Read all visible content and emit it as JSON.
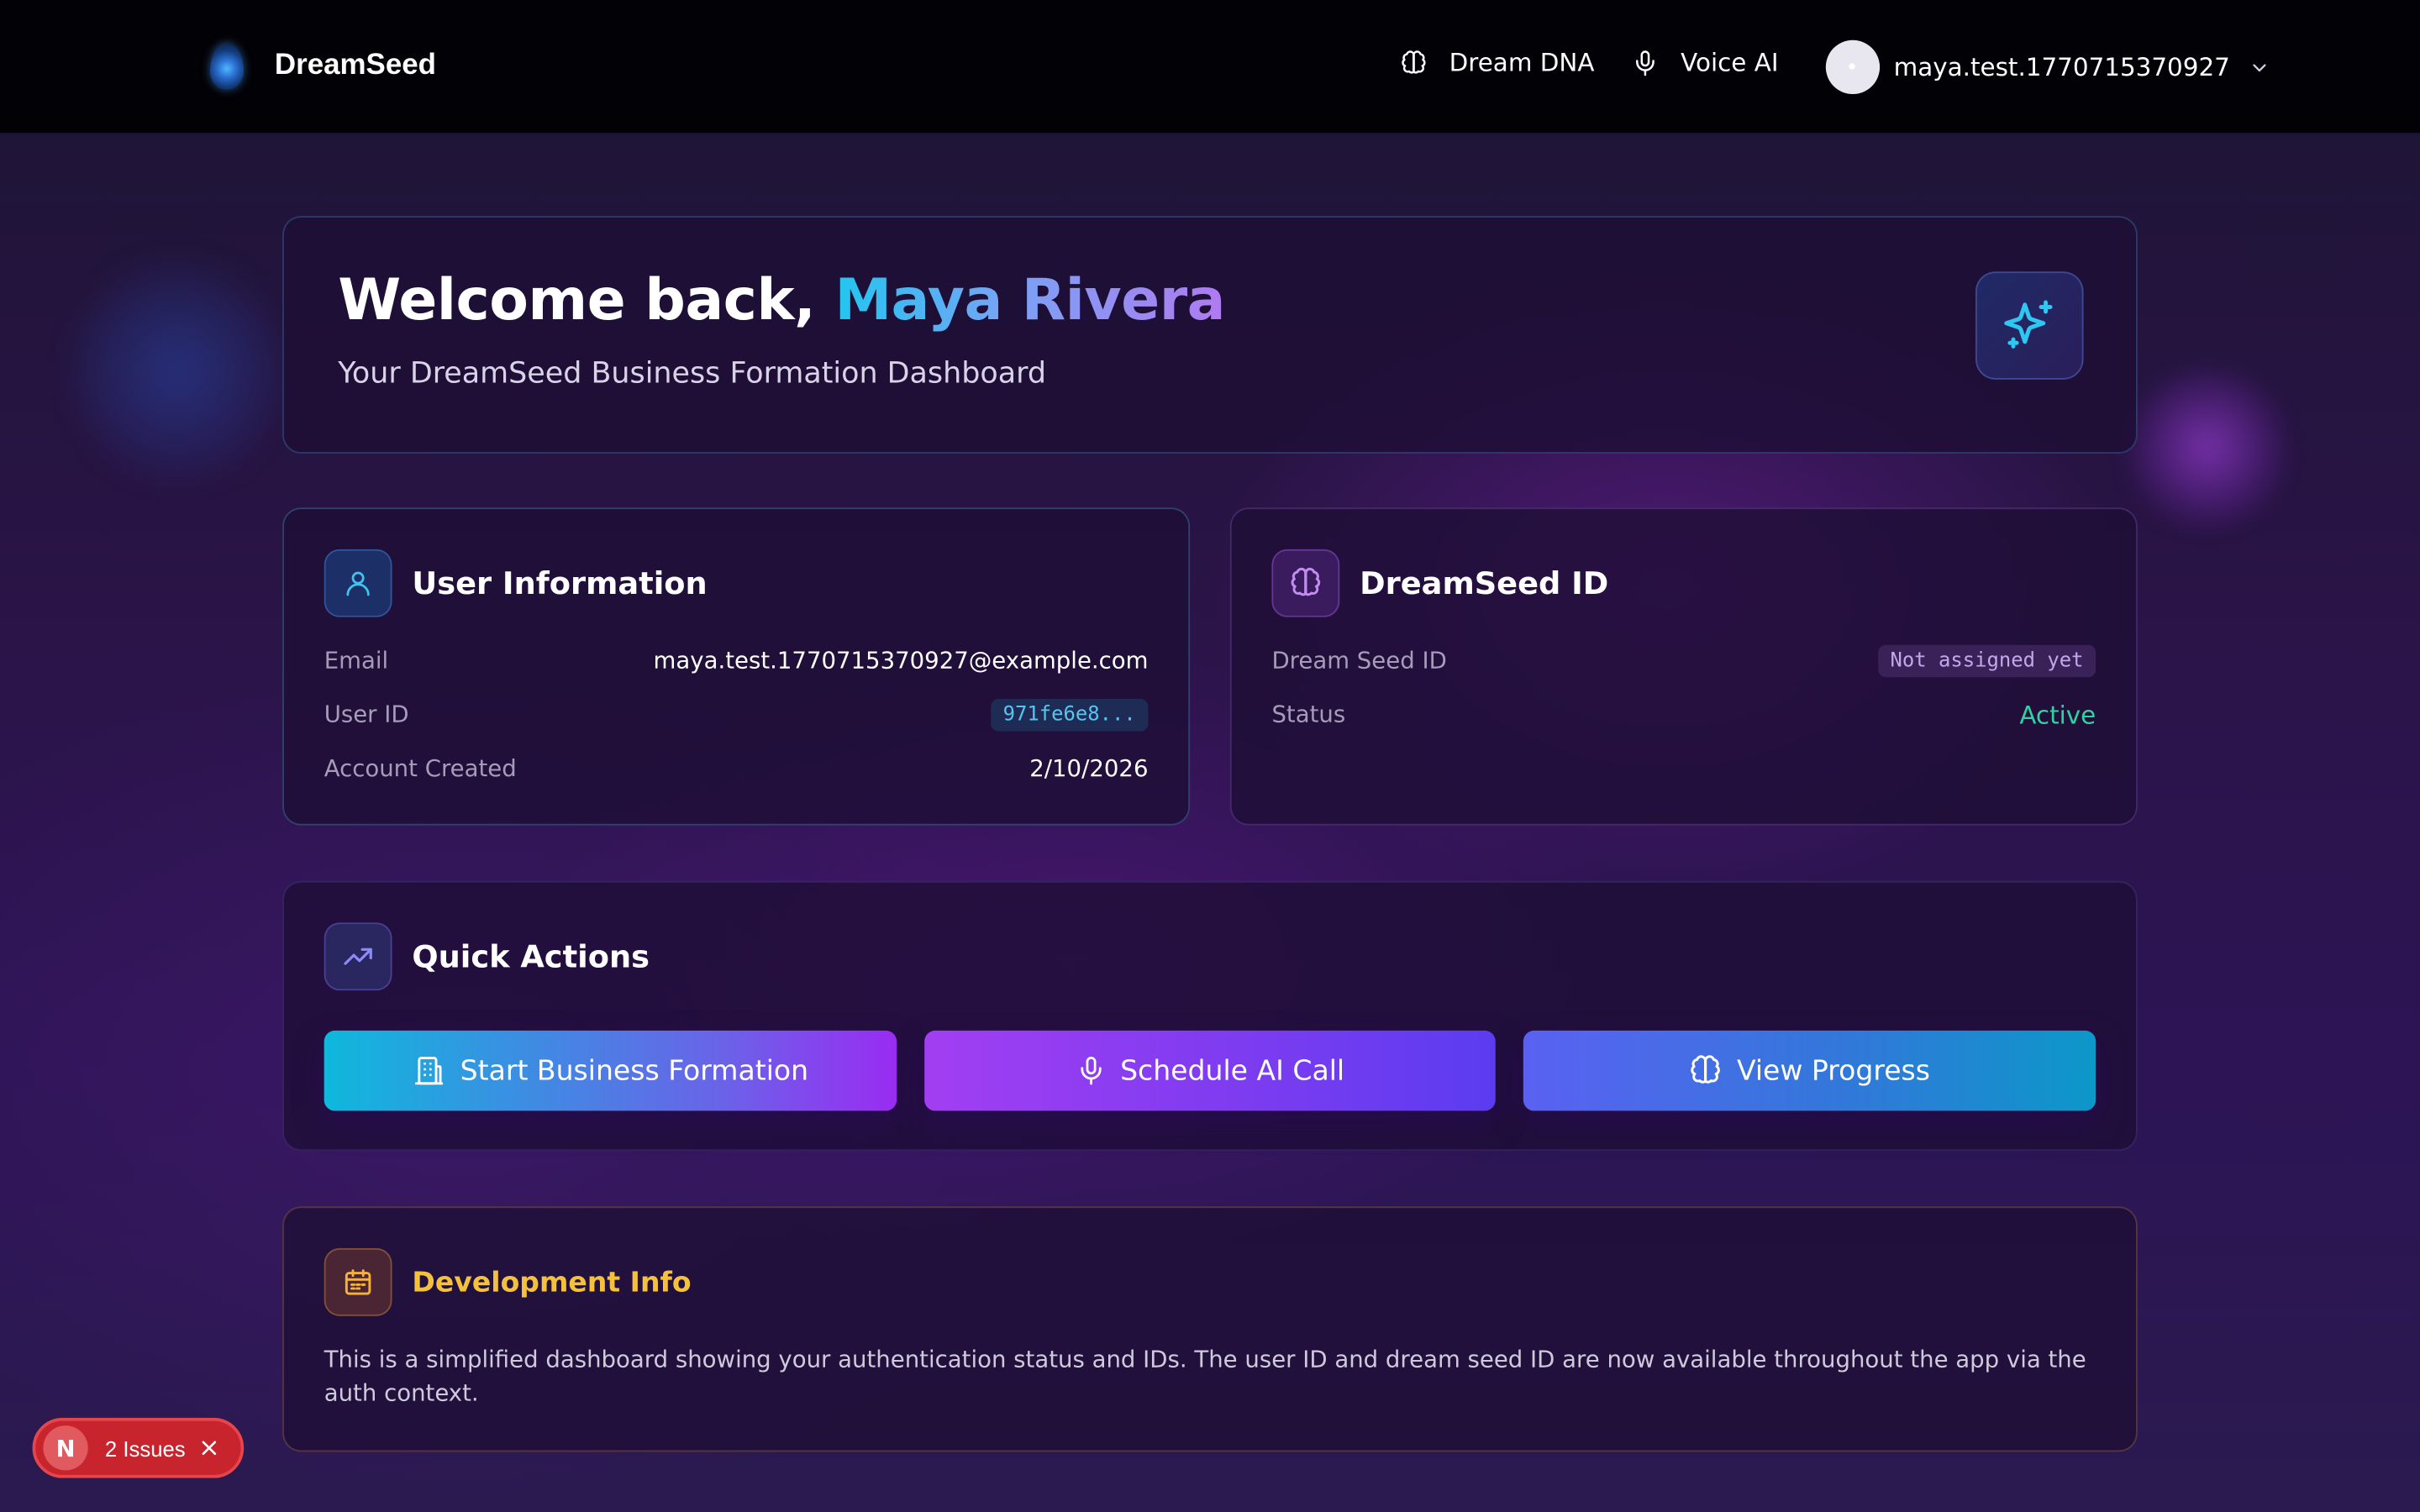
{
  "nav": {
    "brand": "DreamSeed",
    "links": [
      {
        "label": "Dream DNA",
        "icon": "brain-icon"
      },
      {
        "label": "Voice AI",
        "icon": "microphone-icon"
      }
    ],
    "user": "maya.test.1770715370927"
  },
  "welcome": {
    "greeting": "Welcome back, ",
    "name": "Maya Rivera",
    "subtitle": "Your DreamSeed Business Formation Dashboard"
  },
  "user_info": {
    "title": "User Information",
    "rows": [
      {
        "label": "Email",
        "value": "maya.test.1770715370927@example.com"
      },
      {
        "label": "User ID",
        "value": "971fe6e8..."
      },
      {
        "label": "Account Created",
        "value": "2/10/2026"
      }
    ]
  },
  "dreamseed_id": {
    "title": "DreamSeed ID",
    "rows": [
      {
        "label": "Dream Seed ID",
        "value": "Not assigned yet"
      },
      {
        "label": "Status",
        "value": "Active"
      }
    ]
  },
  "quick_actions": {
    "title": "Quick Actions",
    "buttons": [
      {
        "label": "Start Business Formation",
        "icon": "building-icon"
      },
      {
        "label": "Schedule AI Call",
        "icon": "microphone-icon"
      },
      {
        "label": "View Progress",
        "icon": "brain-icon"
      }
    ]
  },
  "dev_info": {
    "title": "Development Info",
    "text": "This is a simplified dashboard showing your authentication status and IDs. The user ID and dream seed ID are now available throughout the app via the auth context."
  },
  "issues_badge": {
    "logo": "N",
    "label": "2 Issues"
  },
  "colors": {
    "accent_cyan": "#22c6f0",
    "status_active": "#2fd3a3",
    "dev_title": "#f5c13c",
    "issues_red": "#c8242d"
  }
}
